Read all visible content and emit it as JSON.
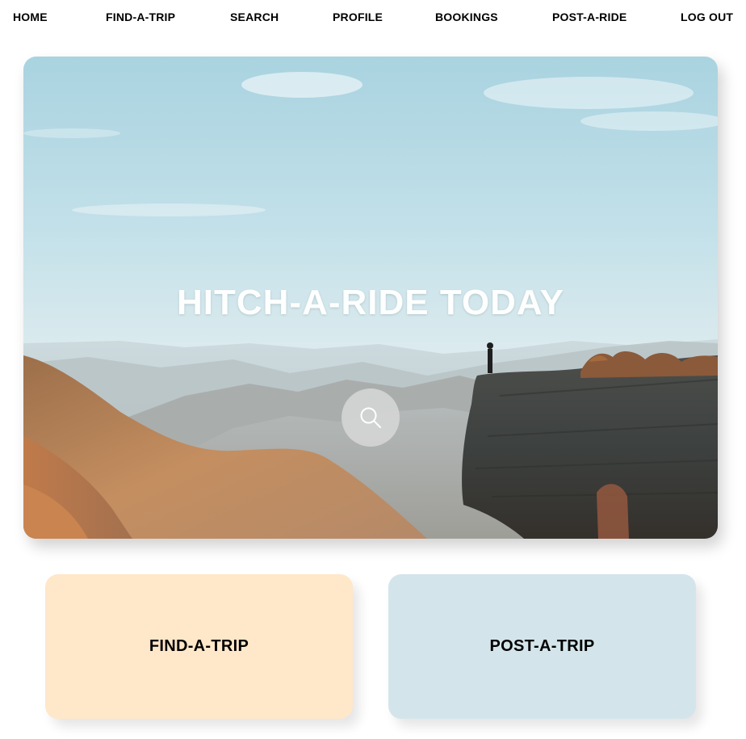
{
  "nav": {
    "items": [
      {
        "label": "HOME"
      },
      {
        "label": "FIND-A-TRIP"
      },
      {
        "label": "SEARCH"
      },
      {
        "label": "PROFILE"
      },
      {
        "label": "BOOKINGS"
      },
      {
        "label": "POST-A-RIDE"
      },
      {
        "label": "LOG OUT"
      }
    ]
  },
  "hero": {
    "title": "HITCH-A-RIDE TODAY",
    "search_icon": "search-icon"
  },
  "cards": {
    "find": {
      "label": "FIND-A-TRIP",
      "color": "#ffe7c9"
    },
    "post": {
      "label": "POST-A-TRIP",
      "color": "#d3e5eb"
    }
  }
}
